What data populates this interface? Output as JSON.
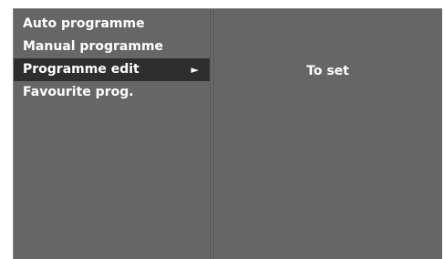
{
  "menu": {
    "items": [
      {
        "label": "Auto programme"
      },
      {
        "label": "Manual programme"
      },
      {
        "label": "Programme edit",
        "arrow": "►"
      },
      {
        "label": "Favourite prog."
      }
    ]
  },
  "right_panel": {
    "hint": "To set"
  },
  "icons": {
    "submenu_arrow": "right-triangle-icon"
  },
  "colors": {
    "panel_bg": "#666666",
    "selected_bg": "#2e2e2e",
    "text": "#ffffff"
  }
}
